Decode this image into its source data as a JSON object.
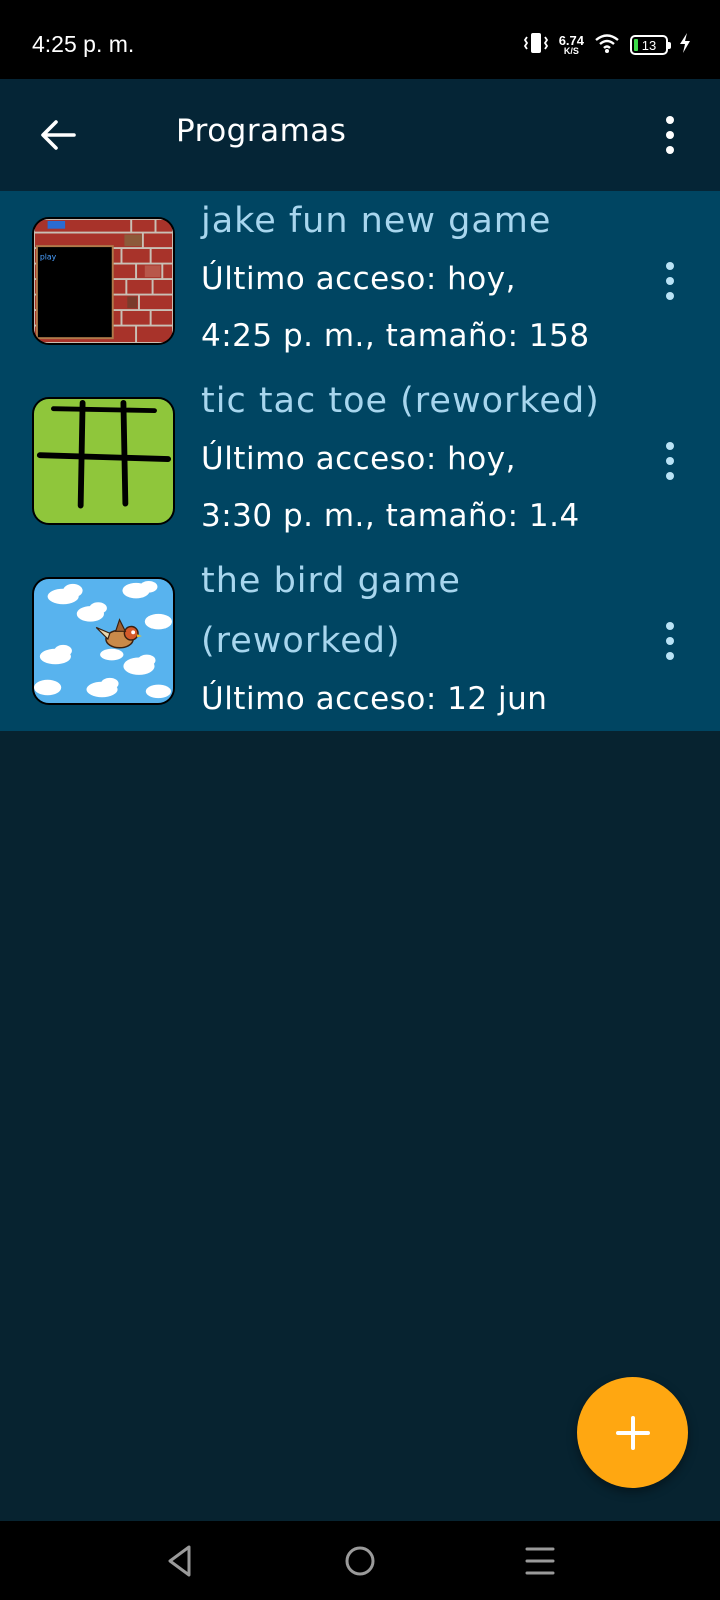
{
  "status_bar": {
    "time": "4:25 p. m.",
    "net_speed_value": "6.74",
    "net_speed_unit": "K/S",
    "battery_level": "13",
    "icons": [
      "vibrate-icon",
      "wifi-icon",
      "battery-icon",
      "charging-icon"
    ]
  },
  "app_bar": {
    "title": "Programas",
    "back_icon": "arrow-left-icon",
    "menu_icon": "more-vert-icon"
  },
  "programs": [
    {
      "name": "jake fun new game",
      "meta": [
        "Último acceso: hoy,",
        "4:25 p.  m., tamaño: 158"
      ],
      "thumbnail": "brick-wall-game-thumbnail",
      "thumbnail_text": "play"
    },
    {
      "name": "tic tac toe (reworked)",
      "meta": [
        "Último acceso: hoy,",
        "3:30 p.  m., tamaño: 1.4"
      ],
      "thumbnail": "tic-tac-toe-grid-thumbnail"
    },
    {
      "name": "the bird game (reworked)",
      "meta": [
        "Último acceso: 12 jun"
      ],
      "thumbnail": "bird-in-clouds-thumbnail"
    }
  ],
  "fab": {
    "icon": "plus-icon"
  },
  "nav_bar": {
    "icons": [
      "nav-back-icon",
      "nav-home-icon",
      "nav-menu-icon"
    ]
  },
  "colors": {
    "background": "#072330",
    "app_bar": "#052536",
    "list_background": "#004562",
    "item_title": "#a8d6ee",
    "fab": "#ffa711"
  }
}
